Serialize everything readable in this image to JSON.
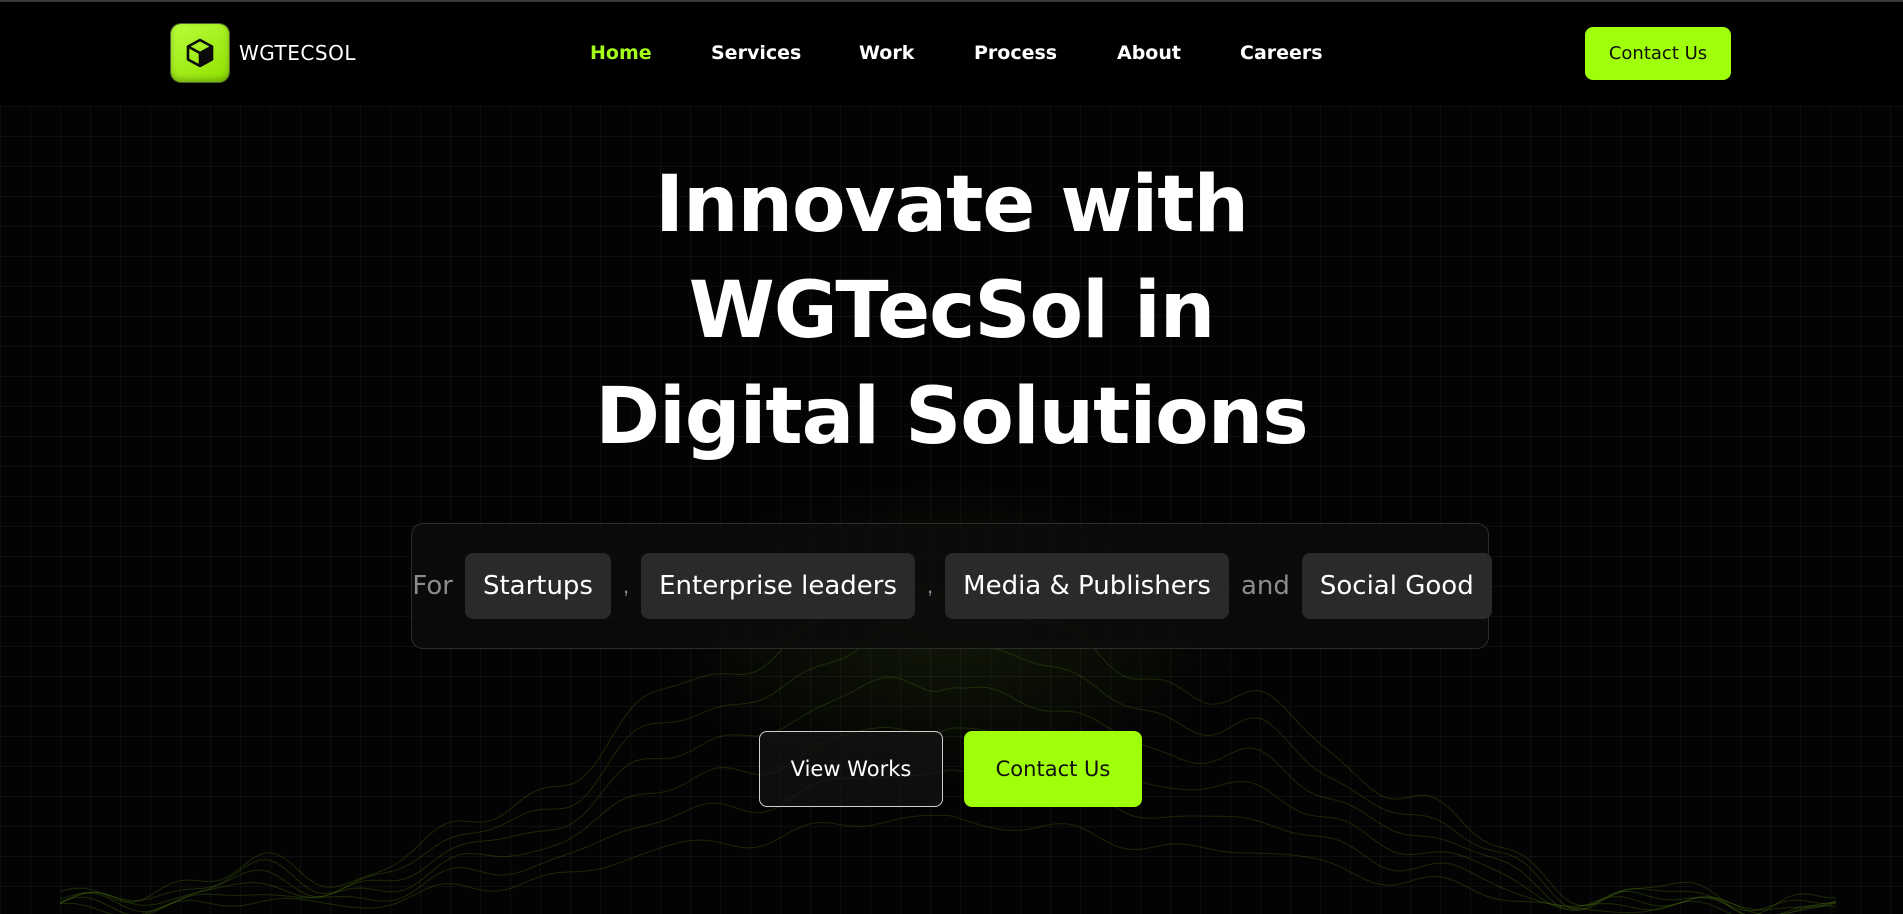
{
  "brand": {
    "name": "WGTECSOL",
    "logo_icon": "cube-icon",
    "accent_color": "#a0ff0a"
  },
  "nav": {
    "items": [
      {
        "label": "Home",
        "active": true
      },
      {
        "label": "Services",
        "active": false
      },
      {
        "label": "Work",
        "active": false
      },
      {
        "label": "Process",
        "active": false
      },
      {
        "label": "About",
        "active": false
      },
      {
        "label": "Careers",
        "active": false
      }
    ],
    "contact_label": "Contact Us"
  },
  "hero": {
    "title_lines": [
      "Innovate with",
      "WGTecSol in",
      "Digital Solutions"
    ],
    "audience": {
      "prefix": "For",
      "chips": [
        "Startups",
        "Enterprise leaders",
        "Media & Publishers",
        "Social Good"
      ],
      "separator": ",",
      "conjunction": "and"
    },
    "view_works_label": "View Works",
    "contact_label": "Contact Us"
  }
}
